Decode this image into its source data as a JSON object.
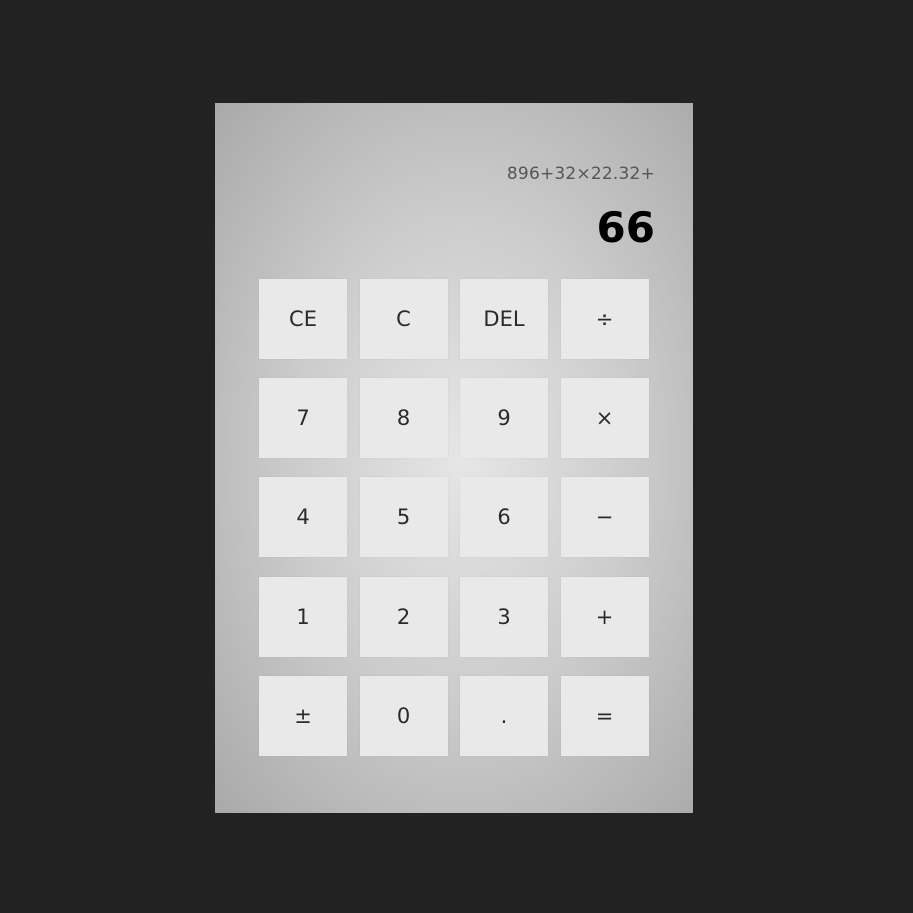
{
  "display": {
    "expression": "896+32×22.32+",
    "result": "66"
  },
  "keys": [
    {
      "label": "CE",
      "name": "clear-entry-button"
    },
    {
      "label": "C",
      "name": "clear-button"
    },
    {
      "label": "DEL",
      "name": "delete-button"
    },
    {
      "label": "÷",
      "name": "divide-button"
    },
    {
      "label": "7",
      "name": "digit-7-button"
    },
    {
      "label": "8",
      "name": "digit-8-button"
    },
    {
      "label": "9",
      "name": "digit-9-button"
    },
    {
      "label": "×",
      "name": "multiply-button"
    },
    {
      "label": "4",
      "name": "digit-4-button"
    },
    {
      "label": "5",
      "name": "digit-5-button"
    },
    {
      "label": "6",
      "name": "digit-6-button"
    },
    {
      "label": "−",
      "name": "subtract-button"
    },
    {
      "label": "1",
      "name": "digit-1-button"
    },
    {
      "label": "2",
      "name": "digit-2-button"
    },
    {
      "label": "3",
      "name": "digit-3-button"
    },
    {
      "label": "+",
      "name": "add-button"
    },
    {
      "label": "±",
      "name": "negate-button"
    },
    {
      "label": "0",
      "name": "digit-0-button"
    },
    {
      "label": ".",
      "name": "decimal-button"
    },
    {
      "label": "=",
      "name": "equals-button"
    }
  ],
  "colors": {
    "page_background": "#222222",
    "key_background": "#e9e9e9",
    "result_text": "#000000",
    "expression_text": "#555555"
  }
}
